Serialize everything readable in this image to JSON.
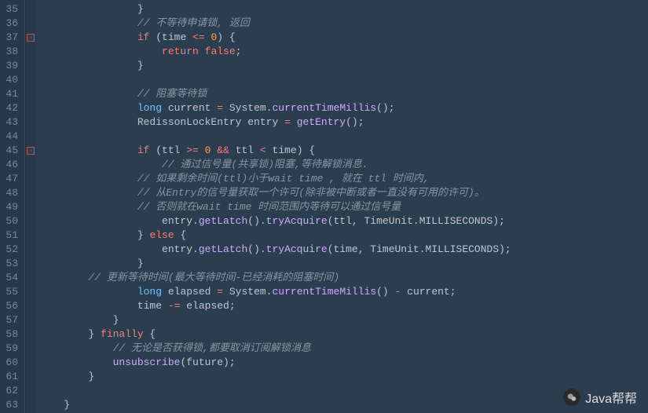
{
  "gutter": {
    "start": 35,
    "end": 63
  },
  "fold_markers": [
    {
      "line": 37,
      "state": "expanded"
    },
    {
      "line": 45,
      "state": "expanded"
    }
  ],
  "code": {
    "35": {
      "indent": "                ",
      "tokens": [
        {
          "t": "}",
          "c": ""
        }
      ]
    },
    "36": {
      "indent": "                ",
      "tokens": [
        {
          "t": "// 不等待申请锁, 返回",
          "c": "cm"
        }
      ]
    },
    "37": {
      "indent": "                ",
      "tokens": [
        {
          "t": "if",
          "c": "kw"
        },
        {
          "t": " (time ",
          "c": ""
        },
        {
          "t": "<=",
          "c": "op"
        },
        {
          "t": " ",
          "c": ""
        },
        {
          "t": "0",
          "c": "num"
        },
        {
          "t": ") {",
          "c": ""
        }
      ]
    },
    "38": {
      "indent": "                    ",
      "tokens": [
        {
          "t": "return",
          "c": "kw"
        },
        {
          "t": " ",
          "c": ""
        },
        {
          "t": "false",
          "c": "kw"
        },
        {
          "t": ";",
          "c": ""
        }
      ]
    },
    "39": {
      "indent": "                ",
      "tokens": [
        {
          "t": "}",
          "c": ""
        }
      ]
    },
    "40": {
      "indent": "",
      "tokens": []
    },
    "41": {
      "indent": "                ",
      "tokens": [
        {
          "t": "// 阻塞等待锁",
          "c": "cm"
        }
      ]
    },
    "42": {
      "indent": "                ",
      "tokens": [
        {
          "t": "long",
          "c": "type"
        },
        {
          "t": " current ",
          "c": ""
        },
        {
          "t": "=",
          "c": "op"
        },
        {
          "t": " System.",
          "c": ""
        },
        {
          "t": "currentTimeMillis",
          "c": "fn"
        },
        {
          "t": "();",
          "c": ""
        }
      ]
    },
    "43": {
      "indent": "                ",
      "tokens": [
        {
          "t": "RedissonLockEntry entry ",
          "c": ""
        },
        {
          "t": "=",
          "c": "op"
        },
        {
          "t": " ",
          "c": ""
        },
        {
          "t": "getEntry",
          "c": "fn"
        },
        {
          "t": "();",
          "c": ""
        }
      ]
    },
    "44": {
      "indent": "",
      "tokens": []
    },
    "45": {
      "indent": "                ",
      "tokens": [
        {
          "t": "if",
          "c": "kw"
        },
        {
          "t": " (ttl ",
          "c": ""
        },
        {
          "t": ">=",
          "c": "op"
        },
        {
          "t": " ",
          "c": ""
        },
        {
          "t": "0",
          "c": "num"
        },
        {
          "t": " ",
          "c": ""
        },
        {
          "t": "&&",
          "c": "op"
        },
        {
          "t": " ttl ",
          "c": ""
        },
        {
          "t": "<",
          "c": "op"
        },
        {
          "t": " time) {",
          "c": ""
        }
      ]
    },
    "46": {
      "indent": "                    ",
      "tokens": [
        {
          "t": "// 通过信号量(共享锁)阻塞,等待解锁消息.",
          "c": "cm"
        }
      ]
    },
    "47": {
      "indent": "                ",
      "tokens": [
        {
          "t": "// 如果剩余时间(ttl)小于wait time , 就在 ttl 时间内,",
          "c": "cm"
        }
      ]
    },
    "48": {
      "indent": "                ",
      "tokens": [
        {
          "t": "// 从Entry的信号量获取一个许可(除非被中断或者一直没有可用的许可)。",
          "c": "cm"
        }
      ]
    },
    "49": {
      "indent": "                ",
      "tokens": [
        {
          "t": "// 否则就在wait time 时间范围内等待可以通过信号量",
          "c": "cm"
        }
      ]
    },
    "50": {
      "indent": "                    ",
      "tokens": [
        {
          "t": "entry.",
          "c": ""
        },
        {
          "t": "getLatch",
          "c": "fn"
        },
        {
          "t": "().",
          "c": ""
        },
        {
          "t": "tryAcquire",
          "c": "fn"
        },
        {
          "t": "(ttl, TimeUnit.MILLISECONDS);",
          "c": ""
        }
      ]
    },
    "51": {
      "indent": "                ",
      "tokens": [
        {
          "t": "} ",
          "c": ""
        },
        {
          "t": "else",
          "c": "kw"
        },
        {
          "t": " {",
          "c": ""
        }
      ]
    },
    "52": {
      "indent": "                    ",
      "tokens": [
        {
          "t": "entry.",
          "c": ""
        },
        {
          "t": "getLatch",
          "c": "fn"
        },
        {
          "t": "().",
          "c": ""
        },
        {
          "t": "tryAcquire",
          "c": "fn"
        },
        {
          "t": "(time, TimeUnit.MILLISECONDS);",
          "c": ""
        }
      ]
    },
    "53": {
      "indent": "                ",
      "tokens": [
        {
          "t": "}",
          "c": ""
        }
      ]
    },
    "54": {
      "indent": "        ",
      "tokens": [
        {
          "t": "// 更新等待时间(最大等待时间-已经消耗的阻塞时间)",
          "c": "cm"
        }
      ]
    },
    "55": {
      "indent": "                ",
      "tokens": [
        {
          "t": "long",
          "c": "type"
        },
        {
          "t": " elapsed ",
          "c": ""
        },
        {
          "t": "=",
          "c": "op"
        },
        {
          "t": " System.",
          "c": ""
        },
        {
          "t": "currentTimeMillis",
          "c": "fn"
        },
        {
          "t": "() ",
          "c": ""
        },
        {
          "t": "-",
          "c": "op"
        },
        {
          "t": " current;",
          "c": ""
        }
      ]
    },
    "56": {
      "indent": "                ",
      "tokens": [
        {
          "t": "time ",
          "c": ""
        },
        {
          "t": "-=",
          "c": "op"
        },
        {
          "t": " elapsed;",
          "c": ""
        }
      ]
    },
    "57": {
      "indent": "            ",
      "tokens": [
        {
          "t": "}",
          "c": ""
        }
      ]
    },
    "58": {
      "indent": "        ",
      "tokens": [
        {
          "t": "} ",
          "c": ""
        },
        {
          "t": "finally",
          "c": "kw"
        },
        {
          "t": " {",
          "c": ""
        }
      ]
    },
    "59": {
      "indent": "            ",
      "tokens": [
        {
          "t": "// 无论是否获得锁,都要取消订阅解锁消息",
          "c": "cm"
        }
      ]
    },
    "60": {
      "indent": "            ",
      "tokens": [
        {
          "t": "unsubscribe",
          "c": "fn"
        },
        {
          "t": "(future);",
          "c": ""
        }
      ]
    },
    "61": {
      "indent": "        ",
      "tokens": [
        {
          "t": "}",
          "c": ""
        }
      ]
    },
    "62": {
      "indent": "",
      "tokens": []
    },
    "63": {
      "indent": "    ",
      "tokens": [
        {
          "t": "}",
          "c": ""
        }
      ]
    }
  },
  "watermark": {
    "text": "Java帮帮",
    "icon_name": "wechat-icon"
  }
}
